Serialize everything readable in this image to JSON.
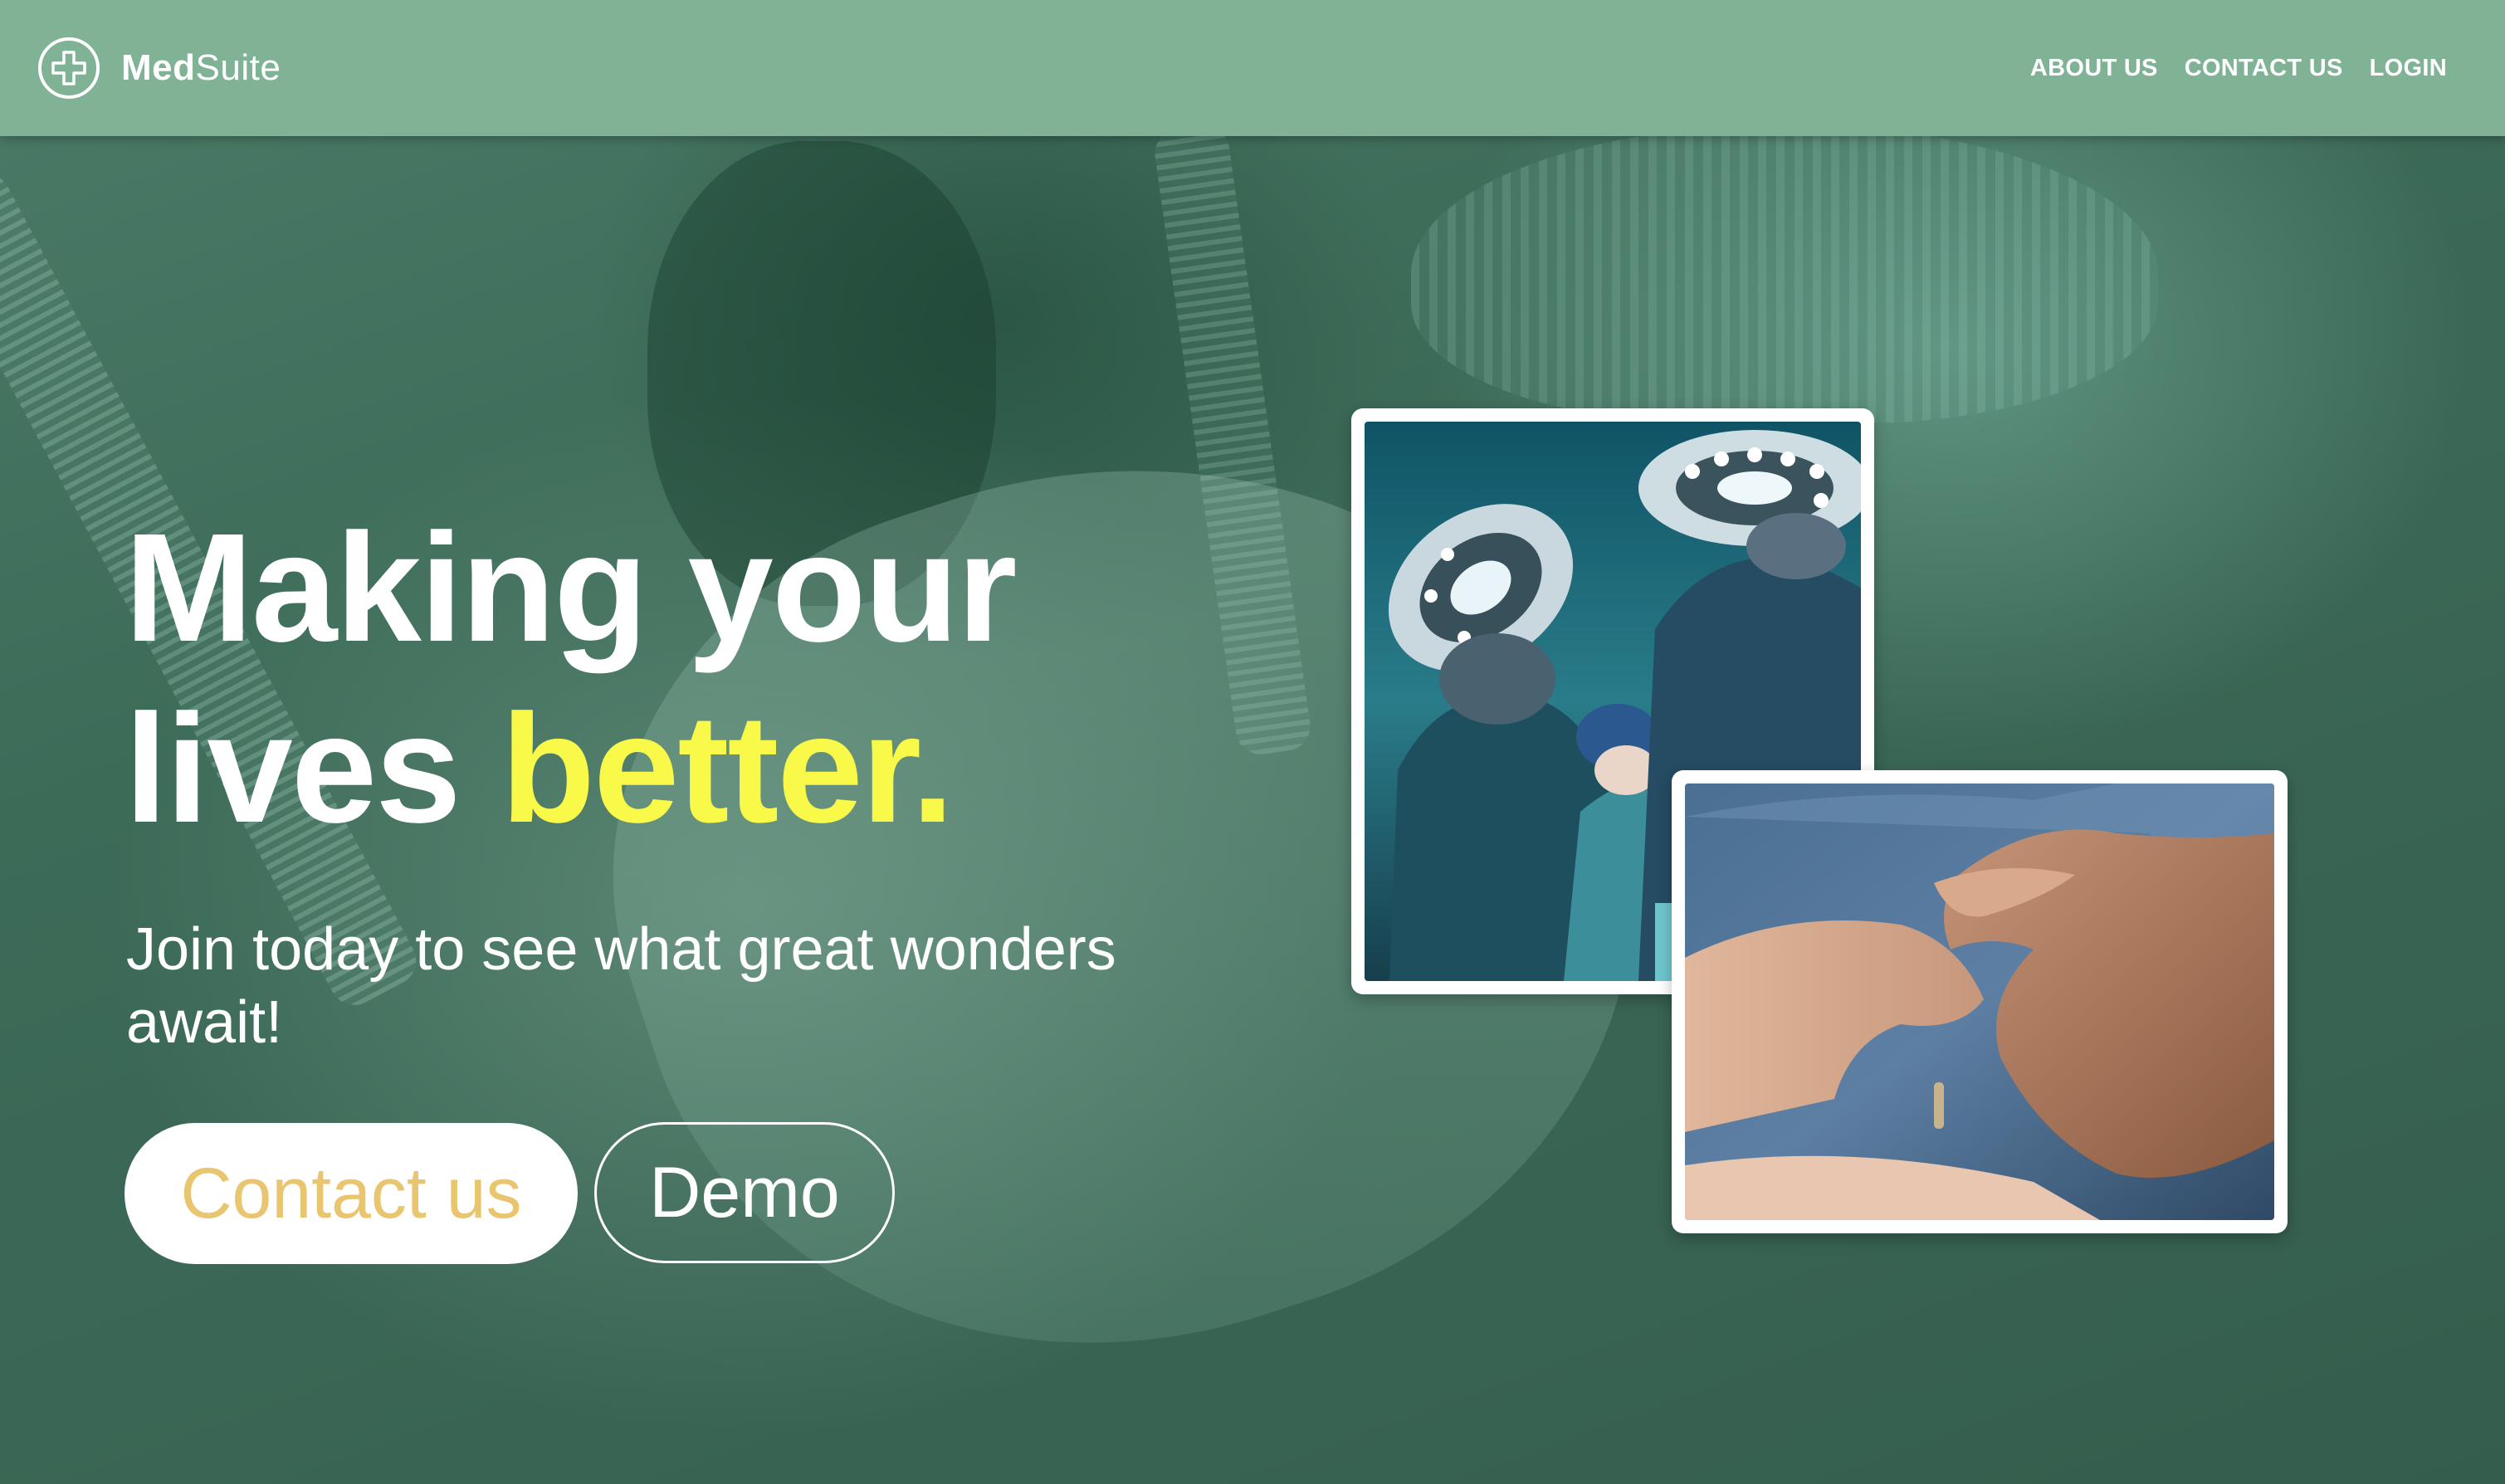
{
  "app": {
    "brand_bold": "Med",
    "brand_light": "Suite"
  },
  "nav": {
    "items": [
      {
        "label": "ABOUT US"
      },
      {
        "label": "CONTACT US"
      },
      {
        "label": "LOGIN"
      }
    ]
  },
  "hero": {
    "title_line1": "Making your",
    "title_line2_plain": "lives ",
    "title_line2_accent": "better.",
    "subtitle": "Join today to see what great wonders await!",
    "buttons": {
      "contact": "Contact us",
      "demo": "Demo"
    }
  },
  "colors": {
    "header_bg": "#80b296",
    "accent_yellow": "#f9f94a",
    "contact_text": "#e8c56e",
    "hero_bg": "#3f6a58"
  },
  "icons": {
    "logo": "medical-cross-icon"
  }
}
